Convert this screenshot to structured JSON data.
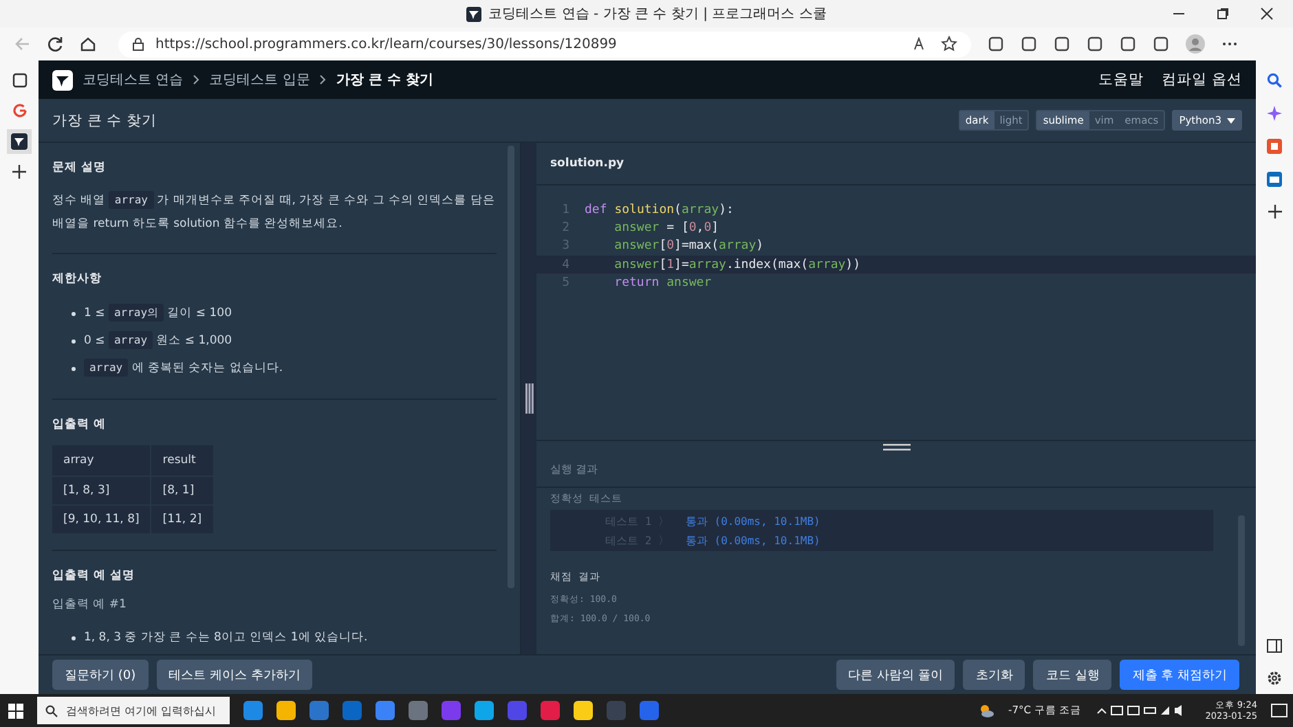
{
  "browser": {
    "tab_title": "코딩테스트 연습 - 가장 큰 수 찾기 | 프로그래머스 스쿨",
    "url": "https://school.programmers.co.kr/learn/courses/30/lessons/120899"
  },
  "nav": {
    "breadcrumbs": [
      "코딩테스트 연습",
      "코딩테스트 입문",
      "가장 큰 수 찾기"
    ],
    "links": [
      "도움말",
      "컴파일 옵션"
    ]
  },
  "header": {
    "title": "가장 큰 수 찾기",
    "themes": [
      {
        "label": "dark",
        "selected": true
      },
      {
        "label": "light",
        "selected": false
      }
    ],
    "keymaps": [
      {
        "label": "sublime",
        "selected": true
      },
      {
        "label": "vim",
        "selected": false
      },
      {
        "label": "emacs",
        "selected": false
      }
    ],
    "language": "Python3"
  },
  "problem": {
    "sections": [
      {
        "heading": "문제 설명",
        "kind": "paragraph",
        "parts": [
          {
            "text": "정수 배열 ",
            "kind": "text"
          },
          {
            "text": "array",
            "kind": "code"
          },
          {
            "text": " 가 매개변수로 주어질 때, 가장 큰 수와 그 수의 인덱스를 담은 배열을 return 하도록 solution 함수를 완성해보세요.",
            "kind": "text"
          }
        ]
      },
      {
        "heading": "제한사항",
        "kind": "bullets",
        "items": [
          [
            {
              "text": "1 ≤ ",
              "kind": "text"
            },
            {
              "text": "array의",
              "kind": "code"
            },
            {
              "text": " 길이 ≤ 100",
              "kind": "text"
            }
          ],
          [
            {
              "text": "0 ≤ ",
              "kind": "text"
            },
            {
              "text": "array",
              "kind": "code"
            },
            {
              "text": " 원소 ≤ 1,000",
              "kind": "text"
            }
          ],
          [
            {
              "text": "array",
              "kind": "code"
            },
            {
              "text": " 에 중복된 숫자는 없습니다.",
              "kind": "text"
            }
          ]
        ]
      },
      {
        "heading": "입출력 예",
        "kind": "table",
        "columns": [
          "array",
          "result"
        ],
        "rows": [
          [
            "[1, 8, 3]",
            "[8, 1]"
          ],
          [
            "[9, 10, 11, 8]",
            "[11, 2]"
          ]
        ]
      },
      {
        "heading": "입출력 예 설명",
        "kind": "explain",
        "subheading": "입출력 예 #1",
        "items": [
          [
            {
              "text": "1, 8, 3 중 가장 큰 수는 8이고 인덱스 1에 있습니다.",
              "kind": "text"
            }
          ]
        ]
      }
    ]
  },
  "editor": {
    "filename": "solution.py",
    "lines": [
      {
        "number": "1",
        "active": false,
        "tokens": [
          {
            "kind": "keyword",
            "text": "def "
          },
          {
            "kind": "func",
            "text": "solution"
          },
          {
            "kind": "plain",
            "text": "("
          },
          {
            "kind": "var",
            "text": "array"
          },
          {
            "kind": "plain",
            "text": "):"
          }
        ]
      },
      {
        "number": "2",
        "active": false,
        "tokens": [
          {
            "kind": "var",
            "text": "    answer"
          },
          {
            "kind": "plain",
            "text": " = ["
          },
          {
            "kind": "num",
            "text": "0"
          },
          {
            "kind": "plain",
            "text": ","
          },
          {
            "kind": "num",
            "text": "0"
          },
          {
            "kind": "plain",
            "text": "]"
          }
        ]
      },
      {
        "number": "3",
        "active": false,
        "tokens": [
          {
            "kind": "var",
            "text": "    answer"
          },
          {
            "kind": "plain",
            "text": "["
          },
          {
            "kind": "num",
            "text": "0"
          },
          {
            "kind": "plain",
            "text": "]=max("
          },
          {
            "kind": "var",
            "text": "array"
          },
          {
            "kind": "plain",
            "text": ")"
          }
        ]
      },
      {
        "number": "4",
        "active": true,
        "tokens": [
          {
            "kind": "var",
            "text": "    answer"
          },
          {
            "kind": "plain",
            "text": "["
          },
          {
            "kind": "num",
            "text": "1"
          },
          {
            "kind": "plain",
            "text": "]="
          },
          {
            "kind": "var",
            "text": "array"
          },
          {
            "kind": "plain",
            "text": ".index(max("
          },
          {
            "kind": "var",
            "text": "array"
          },
          {
            "kind": "plain",
            "text": "))"
          }
        ]
      },
      {
        "number": "5",
        "active": false,
        "tokens": [
          {
            "kind": "keyword",
            "text": "    return "
          },
          {
            "kind": "var",
            "text": "answer"
          }
        ]
      }
    ]
  },
  "result": {
    "title": "실행 결과",
    "test_heading": "정확성  테스트",
    "tests": [
      {
        "name": "테스트 1 〉",
        "result": "통과 (0.00ms, 10.1MB)"
      },
      {
        "name": "테스트 2 〉",
        "result": "통과 (0.00ms, 10.1MB)"
      }
    ],
    "score_heading": "채점 결과",
    "score_lines": [
      "정확성: 100.0",
      "합계: 100.0 / 100.0"
    ]
  },
  "footer": {
    "left_buttons": [
      {
        "label": "질문하기 (0)",
        "primary": false
      },
      {
        "label": "테스트 케이스 추가하기",
        "primary": false
      }
    ],
    "right_buttons": [
      {
        "label": "다른 사람의 풀이",
        "primary": false
      },
      {
        "label": "초기화",
        "primary": false
      },
      {
        "label": "코드 실행",
        "primary": false
      },
      {
        "label": "제출 후 채점하기",
        "primary": true
      }
    ]
  },
  "taskbar": {
    "search_placeholder": "검색하려면 여기에 입력하십시",
    "weather": "-7°C 구름 조금",
    "time": "오후 9:24",
    "date": "2023-01-25"
  }
}
